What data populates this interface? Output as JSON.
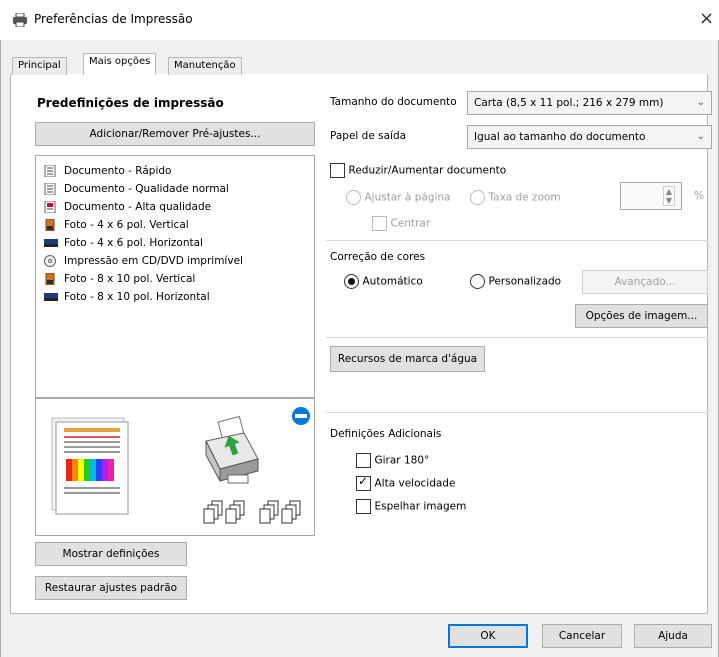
{
  "window": {
    "title": "Preferências de Impressão",
    "close_glyph": "×"
  },
  "tabs": [
    "Principal",
    "Mais opções",
    "Manutenção"
  ],
  "presets": {
    "heading": "Predefinições de impressão",
    "add_remove_button": "Adicionar/Remover Pré-ajustes...",
    "items": [
      {
        "label": "Documento - Rápido",
        "icon": "document-icon"
      },
      {
        "label": "Documento - Qualidade normal",
        "icon": "document-icon"
      },
      {
        "label": "Documento - Alta qualidade",
        "icon": "document-color-icon"
      },
      {
        "label": "Foto - 4 x 6 pol. Vertical",
        "icon": "photo-portrait-icon"
      },
      {
        "label": "Foto - 4 x 6 pol. Horizontal",
        "icon": "photo-landscape-icon"
      },
      {
        "label": "Impressão em CD/DVD imprimível",
        "icon": "cd-icon"
      },
      {
        "label": "Foto - 8 x 10 pol. Vertical",
        "icon": "photo-portrait-icon"
      },
      {
        "label": "Foto - 8 x 10 pol. Horizontal",
        "icon": "photo-landscape-icon"
      }
    ]
  },
  "buttons": {
    "show_settings": "Mostrar definições",
    "restore_defaults": "Restaurar ajustes padrão",
    "ok": "OK",
    "cancel": "Cancelar",
    "help": "Ajuda"
  },
  "document": {
    "size_label": "Tamanho do documento",
    "size_value": "Carta (8,5 x 11 pol.; 216 x 279 mm)",
    "output_label": "Papel de saída",
    "output_value": "Igual ao tamanho do documento",
    "reduce_enlarge": "Reduzir/Aumentar documento",
    "fit_page": "Ajustar à página",
    "zoom_rate": "Taxa de zoom",
    "zoom_unit": "%",
    "center": "Centrar"
  },
  "color": {
    "heading": "Correção de cores",
    "automatic": "Automático",
    "custom": "Personalizado",
    "advanced": "Avançado...",
    "image_options": "Opções de imagem..."
  },
  "watermark_button": "Recursos de marca d'água",
  "additional": {
    "heading": "Definições Adicionais",
    "rotate": "Girar 180°",
    "high_speed": "Alta velocidade",
    "mirror": "Espelhar imagem",
    "high_speed_checked": true
  },
  "colors": {
    "accent": "#0078d7",
    "arrow_green": "#2ea043"
  }
}
